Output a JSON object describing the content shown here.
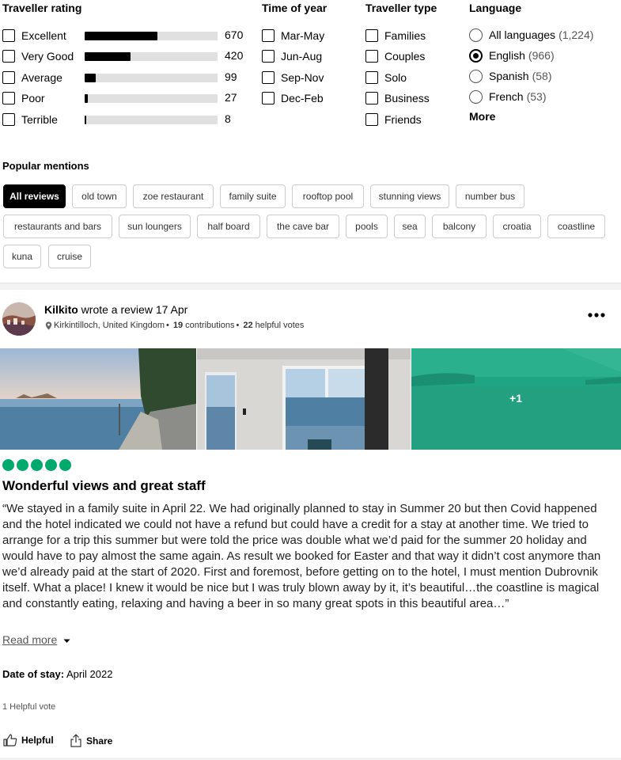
{
  "filters": {
    "rating": {
      "title": "Traveller rating",
      "items": [
        {
          "label": "Excellent",
          "count": "670",
          "fraction": 0.547
        },
        {
          "label": "Very Good",
          "count": "420",
          "fraction": 0.343
        },
        {
          "label": "Average",
          "count": "99",
          "fraction": 0.081
        },
        {
          "label": "Poor",
          "count": "27",
          "fraction": 0.022
        },
        {
          "label": "Terrible",
          "count": "8",
          "fraction": 0.007
        }
      ]
    },
    "time": {
      "title": "Time of year",
      "items": [
        "Mar-May",
        "Jun-Aug",
        "Sep-Nov",
        "Dec-Feb"
      ]
    },
    "type": {
      "title": "Traveller type",
      "items": [
        "Families",
        "Couples",
        "Solo",
        "Business",
        "Friends"
      ]
    },
    "language": {
      "title": "Language",
      "items": [
        {
          "label": "All languages",
          "count": "(1,224)",
          "selected": false
        },
        {
          "label": "English",
          "count": "(966)",
          "selected": true
        },
        {
          "label": "Spanish",
          "count": "(58)",
          "selected": false
        },
        {
          "label": "French",
          "count": "(53)",
          "selected": false
        }
      ],
      "more": "More"
    }
  },
  "popular": {
    "title": "Popular mentions",
    "chips": [
      "All reviews",
      "old town",
      "zoe restaurant",
      "family suite",
      "rooftop pool",
      "stunning views",
      "number bus",
      "restaurants and bars",
      "sun loungers",
      "half board",
      "the cave bar",
      "pools",
      "sea",
      "balcony",
      "croatia",
      "coastline",
      "kuna",
      "cruise"
    ]
  },
  "review": {
    "author": "Kilkito",
    "wrote": "wrote a review 17 Apr",
    "location": "Kirkintilloch, United Kingdom",
    "contributions_num": "19",
    "contributions_text": "contributions",
    "helpful_num": "22",
    "helpful_text": "helpful votes",
    "more_photos": "+1",
    "rating": 5,
    "title": "Wonderful views and great staff",
    "body": "“We stayed in a family suite in April 22. We had originally planned to stay in Summer 20 but then Covid happened and the hotel indicated we could not have a refund but could have a credit for a stay at another time. We tried to arrange for a trip this summer but were told the price was double what we’d paid for the summer 20 holiday and would have to pay almost the same again. As result we booked for Easter and that way it didn’t cost anymore than we’d already paid at the start of 2020. First and foremost, before getting on to the hotel, I must mention Dubrovnik itself. What a place! I knew it would be nice but I was truly blown away by it, it’s beautiful…the coastline is magical and constantly eating, relaxing and having a beer in so many great spots in this beautiful area…”",
    "read_more": "Read more",
    "date_label": "Date of stay:",
    "date_value": "April 2022",
    "helpful_votes": "1 Helpful vote",
    "helpful_btn": "Helpful",
    "share_btn": "Share"
  },
  "colors": {
    "accent": "#00aa6c",
    "bar_bg": "#e0e0e0",
    "photo3_tint": "#1fa583"
  },
  "icons": [
    "checkbox",
    "radio",
    "location-pin-icon",
    "more-dots-icon",
    "chevron-down-icon",
    "thumbs-up-icon",
    "share-icon"
  ]
}
